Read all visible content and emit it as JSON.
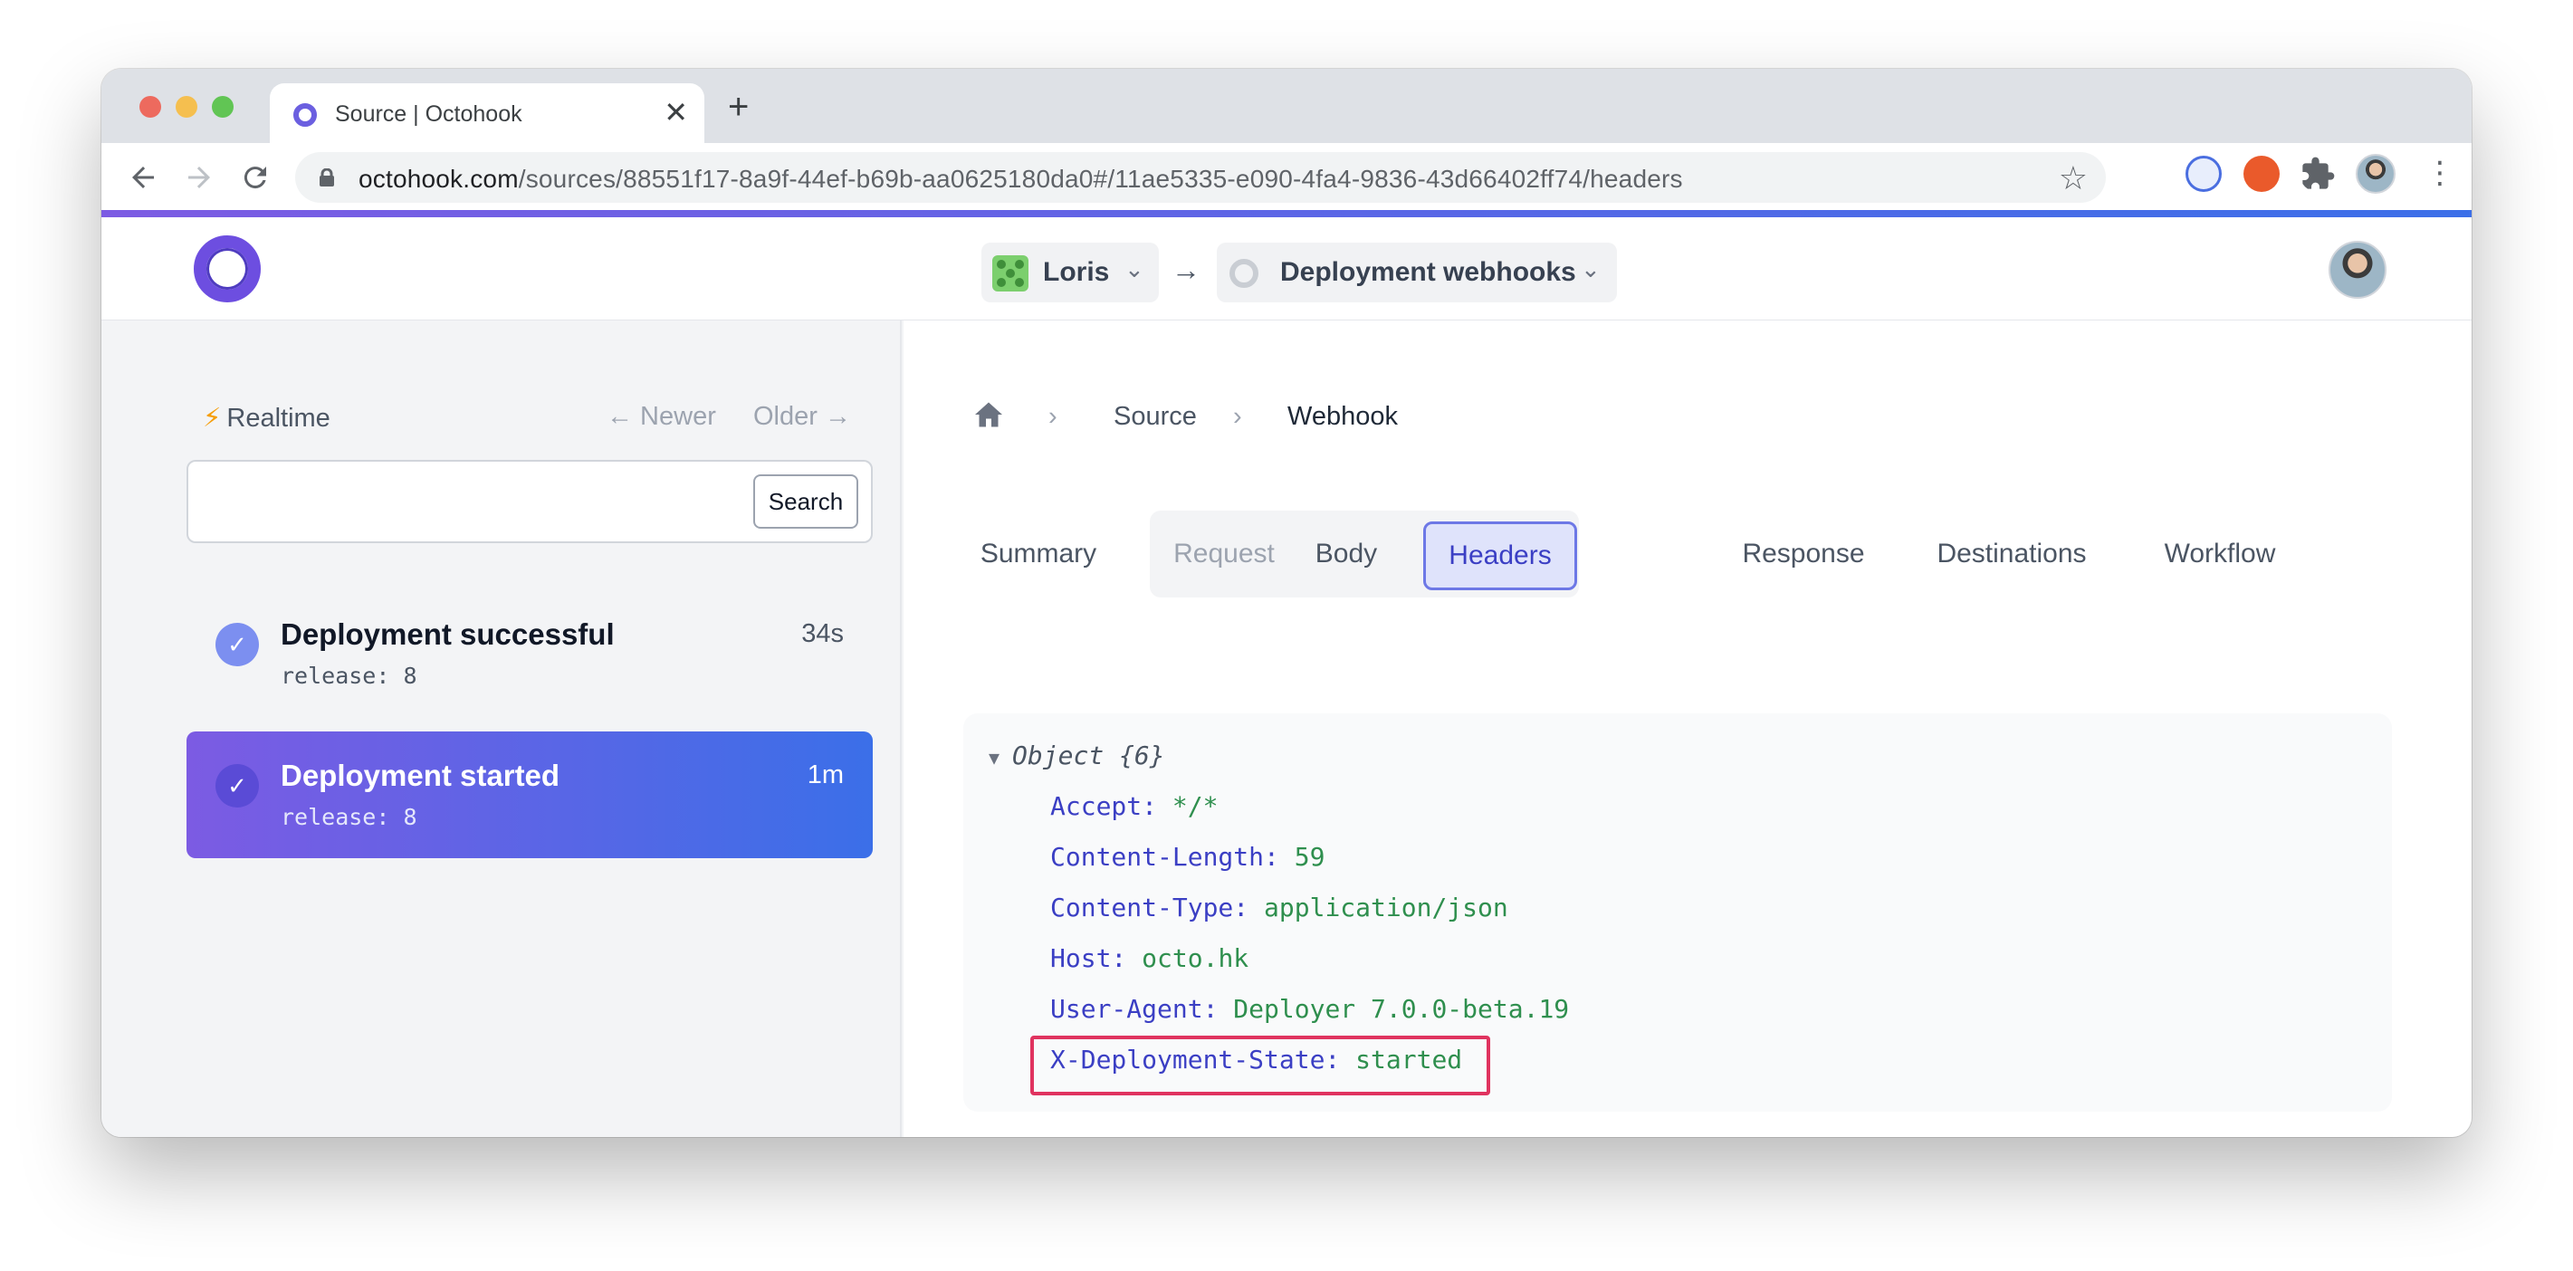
{
  "browser": {
    "tab_title": "Source | Octohook",
    "tab_close": "✕",
    "new_tab": "+",
    "url_domain": "octohook.com",
    "url_path": "/sources/88551f17-8a9f-44ef-b69b-aa0625180da0#/11ae5335-e090-4fa4-9836-43d66402ff74/headers"
  },
  "header": {
    "org_name": "Loris",
    "source_name": "Deployment webhooks",
    "arrow": "→"
  },
  "sidebar": {
    "realtime_label": "Realtime",
    "newer_label": "← Newer",
    "older_label": "Older →",
    "search_button": "Search",
    "search_value": "",
    "events": [
      {
        "title": "Deployment successful",
        "subtitle": "release: 8",
        "time": "34s"
      },
      {
        "title": "Deployment started",
        "subtitle": "release: 8",
        "time": "1m"
      }
    ]
  },
  "main": {
    "breadcrumb": [
      "Source",
      "Webhook"
    ],
    "tabs": [
      "Summary",
      "Request",
      "Body",
      "Headers",
      "Response",
      "Destinations",
      "Workflow"
    ],
    "active_tab": "Headers",
    "object_label": "Object {6}",
    "headers": [
      {
        "key": "Accept:",
        "value": "*/*"
      },
      {
        "key": "Content-Length:",
        "value": "59"
      },
      {
        "key": "Content-Type:",
        "value": "application/json"
      },
      {
        "key": "Host:",
        "value": "octo.hk"
      },
      {
        "key": "User-Agent:",
        "value": "Deployer 7.0.0-beta.19"
      },
      {
        "key": "X-Deployment-State:",
        "value": "started"
      }
    ]
  },
  "colors": {
    "accent": "#6d4ee0",
    "active_event_gradient_start": "#7c5be3",
    "active_event_gradient_end": "#3b6fe8",
    "highlight_border": "#e0335f",
    "json_key": "#3b3fc4",
    "json_value": "#2f8f4e"
  }
}
